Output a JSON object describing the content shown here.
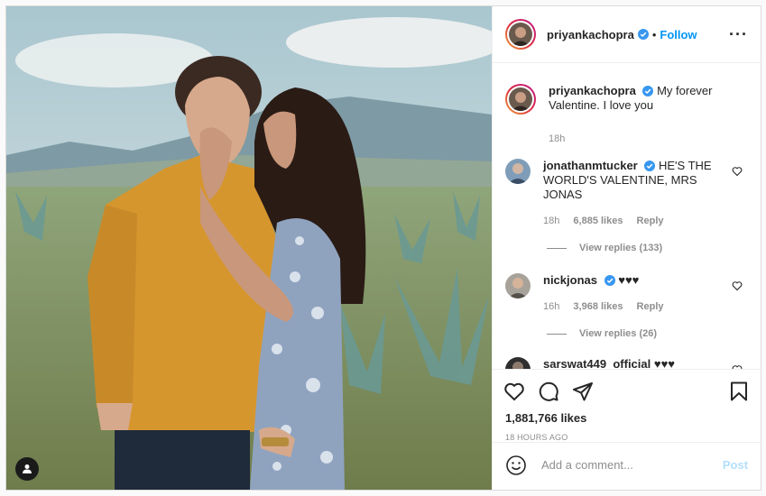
{
  "author": {
    "username": "priyankachopra",
    "verified": true,
    "follow_label": "Follow",
    "separator": "•"
  },
  "caption": {
    "username": "priyankachopra",
    "text": "My forever Valentine. I love you",
    "time": "18h"
  },
  "comments": [
    {
      "username": "jonathanmtucker",
      "verified": true,
      "text": "HE'S THE WORLD'S VALENTINE, MRS JONAS",
      "time": "18h",
      "likes": "6,885 likes",
      "reply_label": "Reply",
      "view_replies": "View replies (133)"
    },
    {
      "username": "nickjonas",
      "verified": true,
      "text": "♥♥♥",
      "time": "16h",
      "likes": "3,968 likes",
      "reply_label": "Reply",
      "view_replies": "View replies (26)"
    },
    {
      "username": "sarswat449_official",
      "verified": false,
      "text": "♥♥♥"
    }
  ],
  "actions": {
    "like_icon": "heart-icon",
    "comment_icon": "comment-icon",
    "share_icon": "share-icon",
    "save_icon": "bookmark-icon"
  },
  "likes_count": "1,881,766 likes",
  "post_time": "18 HOURS AGO",
  "add_comment": {
    "placeholder": "Add a comment...",
    "post_label": "Post"
  },
  "colors": {
    "accent": "#0095f6",
    "post_disabled": "#b2dffc",
    "muted": "#8e8e8e"
  }
}
